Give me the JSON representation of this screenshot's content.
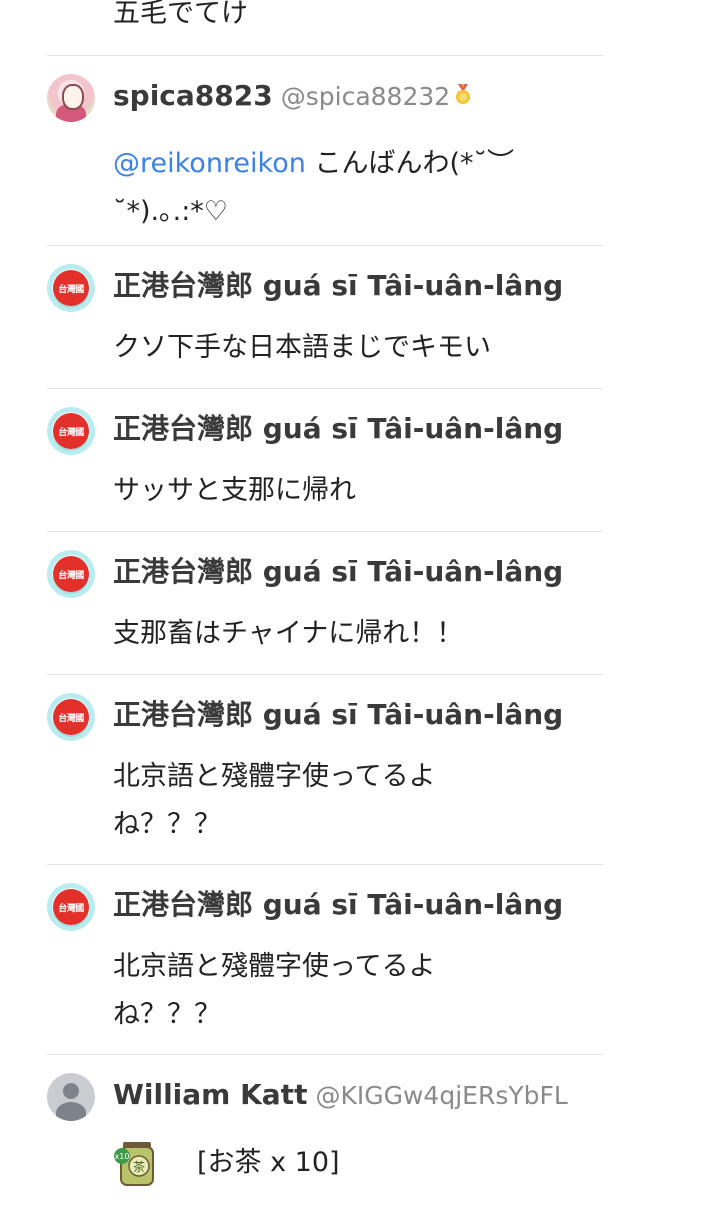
{
  "top_fragment": {
    "text": "五毛でてけ"
  },
  "comments": [
    {
      "display_name": "spica8823",
      "handle": "@spica88232",
      "mention": "@reikonreikon",
      "text_line1": " こんばんわ(*˘︶",
      "text_line2": "˘*).｡.:*♡"
    },
    {
      "display_name": "正港台灣郎 guá sī Tâi-uân-lâng",
      "avatar_text": "台灣國",
      "text": "クソ下手な日本語まじでキモい"
    },
    {
      "display_name": "正港台灣郎 guá sī Tâi-uân-lâng",
      "avatar_text": "台灣國",
      "text": "サッサと支那に帰れ"
    },
    {
      "display_name": "正港台灣郎 guá sī Tâi-uân-lâng",
      "avatar_text": "台灣國",
      "text": "支那畜はチャイナに帰れ！！"
    },
    {
      "display_name": "正港台灣郎 guá sī Tâi-uân-lâng",
      "avatar_text": "台灣國",
      "text_line1": "北京語と殘體字使ってるよ",
      "text_line2": "ね？？？"
    },
    {
      "display_name": "正港台灣郎 guá sī Tâi-uân-lâng",
      "avatar_text": "台灣國",
      "text_line1": "北京語と殘體字使ってるよ",
      "text_line2": "ね？？？"
    },
    {
      "display_name": "William Katt",
      "handle": "@KIGGw4qjERsYbFL",
      "gift_icon": "tea-icon",
      "gift_badge": "x10",
      "gift_text": "[お茶 x 10]"
    }
  ],
  "colors": {
    "mention": "#3b82e8",
    "handle": "#8a8a8a",
    "divider": "#e3e3e3",
    "avatar_red": "#e3302a"
  }
}
